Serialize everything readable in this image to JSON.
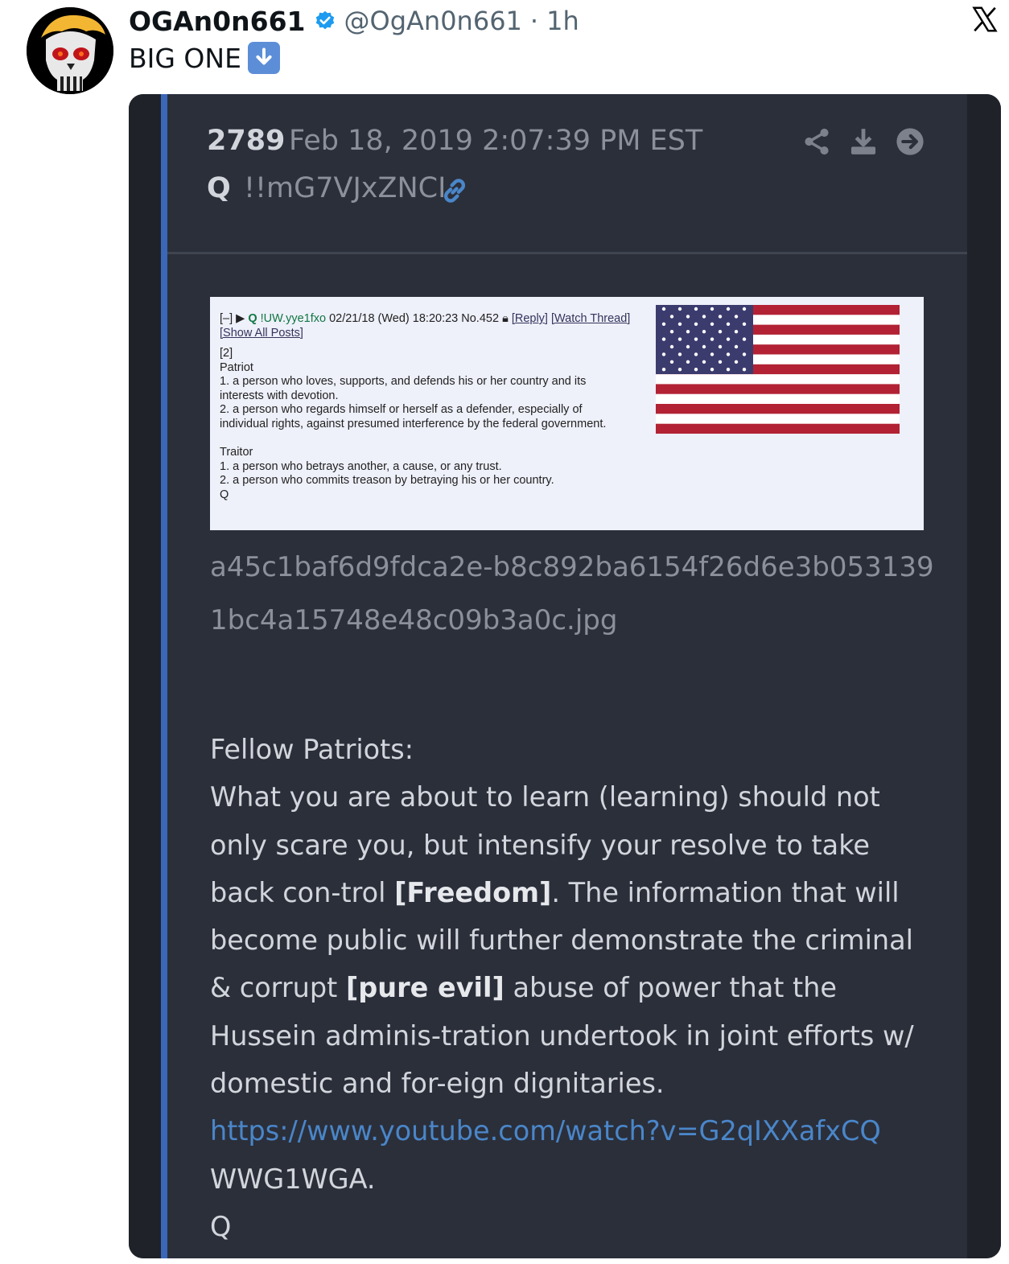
{
  "tweet": {
    "display_name": "OGAn0n661",
    "handle": "@OgAn0n661",
    "separator": "·",
    "time": "1h",
    "text": "BIG ONE"
  },
  "post": {
    "number": "2789",
    "date": "Feb 18, 2019 2:07:39 PM EST",
    "author": "Q",
    "tripcode": "!!mG7VJxZNCI",
    "image": {
      "toggle": "[–]",
      "name": "Q",
      "trip": "!UW.yye1fxo",
      "datetime": "02/21/18 (Wed) 18:20:23",
      "post_no": "No.452",
      "reply": "[Reply]",
      "watch_thread": "[Watch Thread]",
      "show_all": "[Show All Posts]",
      "lines": [
        "[2]",
        "Patriot",
        "1. a person who loves, supports, and defends his or her country and its interests with devotion.",
        "2. a person who regards himself or herself as a defender, especially of individual rights, against presumed interference by the federal government.",
        "",
        "Traitor",
        "1. a person who betrays another, a cause, or any trust.",
        "2. a person who commits treason by betraying his or her country.",
        "Q"
      ]
    },
    "filename": "a45c1baf6d9fdca2e-b8c892ba6154f26d6e3b0531391bc4a15748e48c09b3a0c.jpg",
    "message": {
      "greeting": "Fellow Patriots:",
      "p1": "What you are about to learn (learning) should not only scare you, but intensify your resolve to take back con-trol ",
      "freedom": "[Freedom]",
      "p2": ". The information that will become public will further demonstrate the criminal & corrupt ",
      "pure_evil": "[pure evil]",
      "p3": " abuse of power that the Hussein adminis-tration undertook in joint efforts w/ domestic and for-eign dignitaries.",
      "url": "https://www.youtube.com/watch?v=G2qIXXafxCQ",
      "signoff": "WWG1WGA.",
      "signature": "Q"
    }
  },
  "colors": {
    "card_bg": "#2b2f3a",
    "accent_bar": "#3a67b7",
    "link": "#4a86c9",
    "verified": "#1d9bf0"
  }
}
